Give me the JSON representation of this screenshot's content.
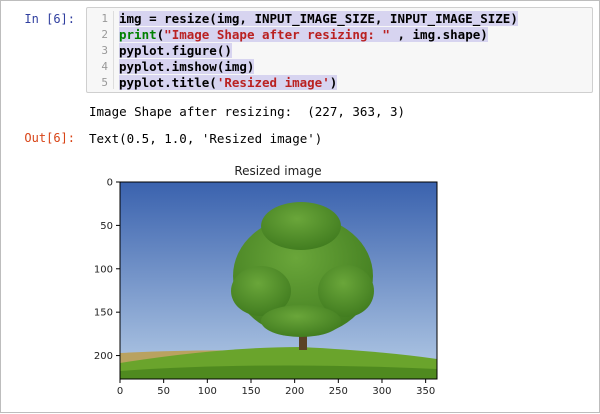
{
  "cell": {
    "in_prompt": "In [6]:",
    "out_prompt": "Out[6]:",
    "line_numbers": [
      "1",
      "2",
      "3",
      "4",
      "5"
    ],
    "code": {
      "l1": "img = resize(img, INPUT_IMAGE_SIZE, INPUT_IMAGE_SIZE)",
      "l2_func": "print",
      "l2_open": "(",
      "l2_str": "\"Image Shape after resizing: \"",
      "l2_rest": " , img.shape)",
      "l3": "pyplot.figure()",
      "l4": "pyplot.imshow(img)",
      "l5_a": "pyplot.title(",
      "l5_str": "'Resized image'",
      "l5_b": ")"
    },
    "stdout": "Image Shape after resizing:  (227, 363, 3)",
    "output_repr": "Text(0.5, 1.0, 'Resized image')"
  },
  "plot": {
    "title": "Resized image",
    "xticks": [
      "0",
      "50",
      "100",
      "150",
      "200",
      "250",
      "300",
      "350"
    ],
    "yticks": [
      "0",
      "50",
      "100",
      "150",
      "200"
    ],
    "colors": {
      "sky_top": "#3a62ae",
      "sky_bottom": "#b4cbe6",
      "grass": "#6aa42c",
      "grass_dark": "#4f8a1f",
      "field_brown": "#b9a260",
      "foliage": "#3f7a1e",
      "foliage_light": "#6aa63a",
      "trunk": "#5b4226"
    }
  }
}
